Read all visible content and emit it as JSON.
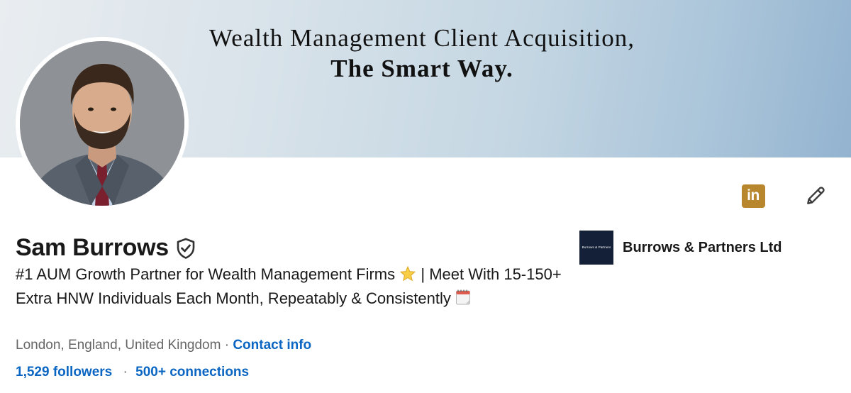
{
  "banner": {
    "line1": "Wealth Management Client Acquisition,",
    "line2": "The Smart Way."
  },
  "profile": {
    "name": "Sam Burrows",
    "headline_part1": "#1 AUM Growth Partner for Wealth Management Firms",
    "headline_part2": "| Meet With 15-150+ Extra HNW Individuals Each Month, Repeatably & Consistently",
    "location": "London, England, United Kingdom",
    "location_separator": "·",
    "contact_info_label": "Contact info",
    "followers_label": "1,529 followers",
    "stats_separator": "·",
    "connections_label": "500+ connections"
  },
  "company": {
    "name": "Burrows & Partners Ltd",
    "logo_text": "Burrows & Partners"
  },
  "actions": {
    "linkedin_badge_text": "in",
    "linkedin_icon": "linkedin-icon",
    "edit_icon": "pencil-icon"
  },
  "colors": {
    "link": "#0a66c2",
    "linkedin_badge": "#b8862d",
    "company_logo_bg": "#132038",
    "text_primary": "#191919",
    "text_secondary": "#666666"
  }
}
